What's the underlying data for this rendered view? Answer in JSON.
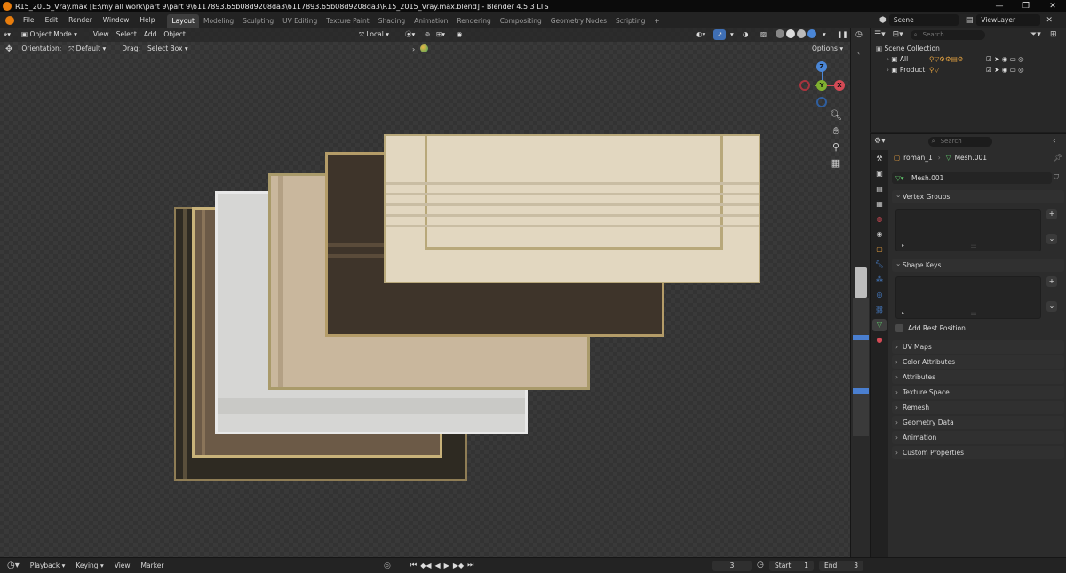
{
  "titlebar": {
    "title": "R15_2015_Vray.max [E:\\my all work\\part 9\\part 9\\6117893.65b08d9208da3\\6117893.65b08d9208da3\\R15_2015_Vray.max.blend] - Blender 4.5.3 LTS",
    "controls": [
      "—",
      "❐",
      "✕"
    ]
  },
  "menu": {
    "items": [
      "File",
      "Edit",
      "Render",
      "Window",
      "Help"
    ],
    "workspaces": [
      "Layout",
      "Modeling",
      "Sculpting",
      "UV Editing",
      "Texture Paint",
      "Shading",
      "Animation",
      "Rendering",
      "Compositing",
      "Geometry Nodes",
      "Scripting"
    ],
    "active_workspace": "Layout",
    "add_tab": "+",
    "scene": "Scene",
    "view_layer": "ViewLayer"
  },
  "viewport": {
    "mode": "Object Mode",
    "header_menu": [
      "View",
      "Select",
      "Add",
      "Object"
    ],
    "transform_space": "Local",
    "orientation_label": "Orientation:",
    "orientation_value": "Default",
    "drag_label": "Drag:",
    "drag_value": "Select Box",
    "options": "Options",
    "gizmo": {
      "z": "Z",
      "y": "Y",
      "x": "X"
    }
  },
  "curtains": [
    {
      "name": "curtain-dark-brown-back",
      "color": "#2e2a22",
      "border": "#8f7d55"
    },
    {
      "name": "curtain-tan-linen",
      "color": "#6c5a47",
      "border": "#c8b27a"
    },
    {
      "name": "curtain-white-linen",
      "color": "#d6d6d4",
      "border": "#e8e8e8"
    },
    {
      "name": "curtain-beige",
      "color": "#c9b79d",
      "border": "#a99a6a"
    },
    {
      "name": "curtain-dark-brown-front",
      "color": "#3e342a",
      "border": "#b49c68"
    },
    {
      "name": "curtain-cream-roman",
      "color": "#e2d7c0",
      "border": "#b8a87a"
    }
  ],
  "outliner": {
    "search_placeholder": "Search",
    "root": "Scene Collection",
    "collections": [
      "All",
      "Product"
    ]
  },
  "properties": {
    "search_placeholder": "Search",
    "object_name": "roman_1",
    "mesh_breadcrumb": "Mesh.001",
    "mesh_name": "Mesh.001",
    "sections_open": [
      "Vertex Groups",
      "Shape Keys"
    ],
    "add_rest_position": "Add Rest Position",
    "sections_closed": [
      "UV Maps",
      "Color Attributes",
      "Attributes",
      "Texture Space",
      "Remesh",
      "Geometry Data",
      "Animation",
      "Custom Properties"
    ]
  },
  "timeline": {
    "menu": [
      "Playback",
      "Keying",
      "View",
      "Marker"
    ],
    "current_frame": "3",
    "start_label": "Start",
    "start_value": "1",
    "end_label": "End",
    "end_value": "3"
  }
}
